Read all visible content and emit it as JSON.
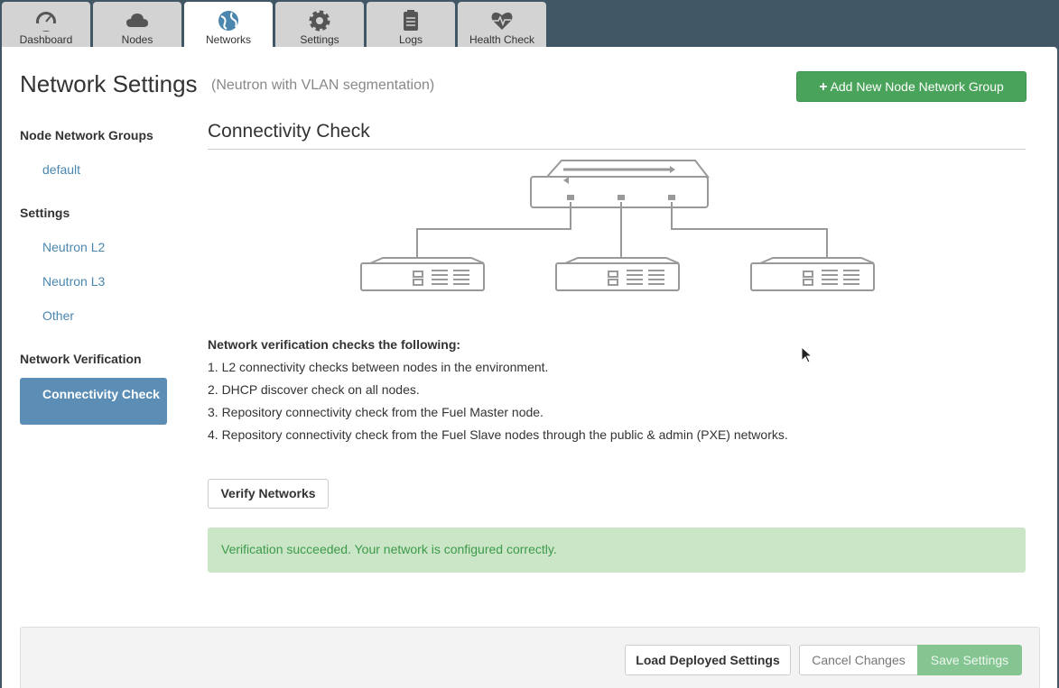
{
  "tabs": [
    {
      "label": "Dashboard",
      "icon": "dashboard-gauge-icon"
    },
    {
      "label": "Nodes",
      "icon": "cloud-icon"
    },
    {
      "label": "Networks",
      "icon": "globe-icon"
    },
    {
      "label": "Settings",
      "icon": "gear-icon"
    },
    {
      "label": "Logs",
      "icon": "clipboard-icon"
    },
    {
      "label": "Health Check",
      "icon": "heartbeat-icon"
    }
  ],
  "active_tab": "Networks",
  "header": {
    "title": "Network Settings",
    "subtitle": "(Neutron with VLAN segmentation)",
    "add_group_label": "Add New Node Network Group"
  },
  "sidebar": {
    "groups_heading": "Node Network Groups",
    "groups": [
      "default"
    ],
    "settings_heading": "Settings",
    "settings_items": [
      "Neutron L2",
      "Neutron L3",
      "Other"
    ],
    "verification_heading": "Network Verification",
    "active_item": "Connectivity Check"
  },
  "main": {
    "section_title": "Connectivity Check",
    "checks_title": "Network verification checks the following:",
    "checks": [
      "1. L2 connectivity checks between nodes in the environment.",
      "2. DHCP discover check on all nodes.",
      "3. Repository connectivity check from the Fuel Master node.",
      "4. Repository connectivity check from the Fuel Slave nodes through the public & admin (PXE) networks."
    ],
    "verify_label": "Verify Networks",
    "success_message": "Verification succeeded. Your network is configured correctly."
  },
  "footer": {
    "load_label": "Load Deployed Settings",
    "cancel_label": "Cancel Changes",
    "save_label": "Save Settings"
  },
  "colors": {
    "topbar": "#415766",
    "success_green": "#4aa35a",
    "active_blue": "#5b8db5",
    "link_blue": "#4a86ae",
    "alert_bg": "#cbe6c7"
  }
}
